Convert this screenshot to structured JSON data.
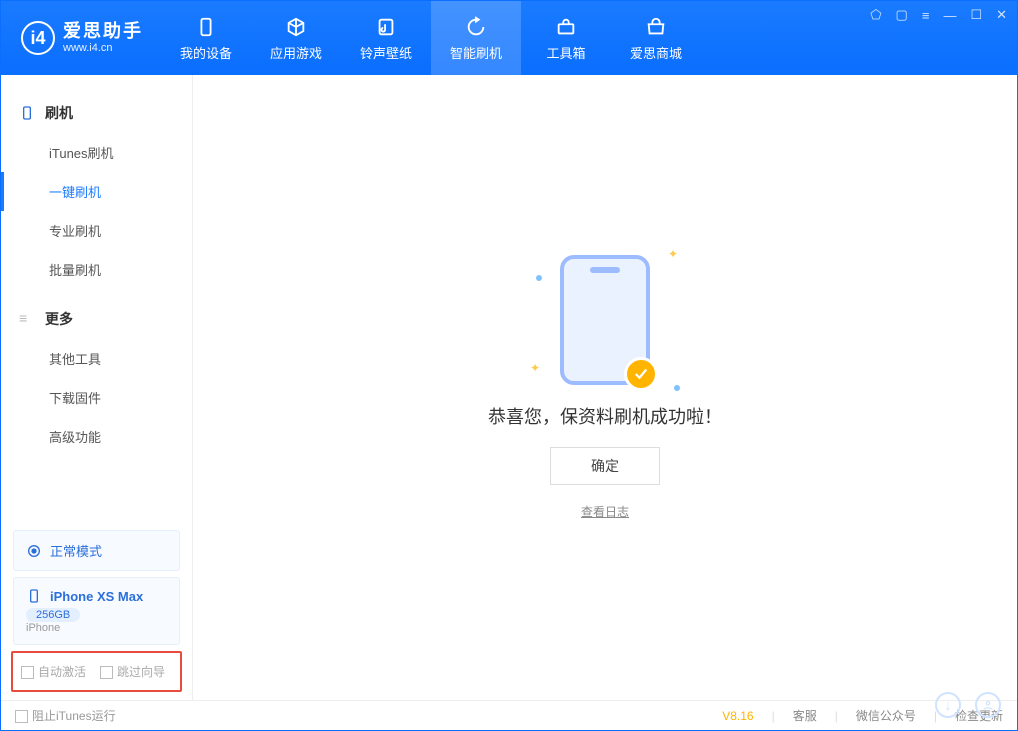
{
  "app": {
    "name": "爱思助手",
    "url": "www.i4.cn"
  },
  "nav": {
    "items": [
      {
        "label": "我的设备"
      },
      {
        "label": "应用游戏"
      },
      {
        "label": "铃声壁纸"
      },
      {
        "label": "智能刷机"
      },
      {
        "label": "工具箱"
      },
      {
        "label": "爱思商城"
      }
    ]
  },
  "sidebar": {
    "group1": {
      "title": "刷机",
      "items": [
        "iTunes刷机",
        "一键刷机",
        "专业刷机",
        "批量刷机"
      ]
    },
    "group2": {
      "title": "更多",
      "items": [
        "其他工具",
        "下载固件",
        "高级功能"
      ]
    }
  },
  "mode_card": {
    "label": "正常模式"
  },
  "device_card": {
    "name": "iPhone XS Max",
    "storage": "256GB",
    "type": "iPhone"
  },
  "options": {
    "auto_activate": "自动激活",
    "skip_wizard": "跳过向导"
  },
  "main": {
    "success": "恭喜您，保资料刷机成功啦！",
    "ok": "确定",
    "view_log": "查看日志"
  },
  "status": {
    "block_itunes": "阻止iTunes运行",
    "version": "V8.16",
    "links": [
      "客服",
      "微信公众号",
      "检查更新"
    ]
  }
}
